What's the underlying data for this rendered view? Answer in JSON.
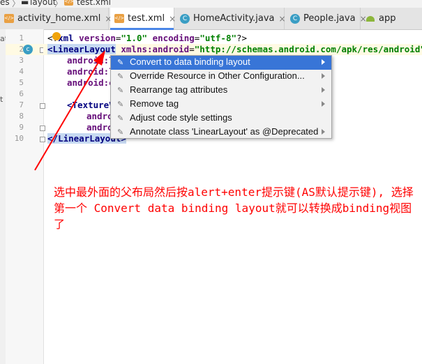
{
  "breadcrumb": {
    "items": [
      "es",
      "layout",
      "test.xml"
    ],
    "separator": "〉"
  },
  "tabs": [
    {
      "label": "activity_home.xml",
      "icon": "xml-file-icon",
      "close": "×"
    },
    {
      "label": "test.xml",
      "icon": "xml-file-icon",
      "close": "×",
      "active": true
    },
    {
      "label": "HomeActivity.java",
      "icon": "class-icon",
      "close": "×"
    },
    {
      "label": "People.java",
      "icon": "class-icon",
      "close": "×"
    },
    {
      "label": "app",
      "icon": "android-icon"
    }
  ],
  "left_panel": {
    "fragments": [
      "at",
      "t"
    ]
  },
  "gutter": {
    "line_numbers": [
      "1",
      "2",
      "3",
      "4",
      "5",
      "6",
      "7",
      "8",
      "9",
      "10"
    ],
    "class_badge": "c"
  },
  "code": {
    "line1": {
      "open": "<?",
      "name": "xml",
      "a1": "version",
      "v1": "\"1.0\"",
      "a2": "encoding",
      "v2": "\"utf-8\"",
      "close": "?>"
    },
    "line2": {
      "open": "<",
      "tag": "LinearLayout",
      "attr": "xmlns:android",
      "eq": "=",
      "val": "\"http://schemas.android.com/apk/res/android\""
    },
    "line3": "android:l",
    "line4": "android:l",
    "line5": "android:o",
    "line7": "<TextureV",
    "line8": "andro",
    "line9": "andro",
    "line10": {
      "open": "</",
      "tag": "LinearLayout",
      "close": ">"
    }
  },
  "context_menu": {
    "items": [
      {
        "label": "Convert to data binding layout",
        "icon": "pencil-icon",
        "submenu": true,
        "active": true
      },
      {
        "label": "Override Resource in Other Configuration...",
        "icon": "pencil-icon",
        "submenu": true
      },
      {
        "label": "Rearrange tag attributes",
        "icon": "pencil-icon",
        "submenu": true
      },
      {
        "label": "Remove tag",
        "icon": "pencil-icon",
        "submenu": true
      },
      {
        "label": "Adjust code style settings",
        "icon": "pencil-icon",
        "submenu": false
      },
      {
        "label": "Annotate class 'LinearLayout' as @Deprecated",
        "icon": "pencil-icon",
        "submenu": true
      }
    ]
  },
  "annotation": {
    "text": "选中最外面的父布局然后按alert+enter提示键(AS默认提示键), 选择第一个 Convert data binding layout就可以转换成binding视图了",
    "color": "#ff0000"
  },
  "colors": {
    "accent": "#3875d7",
    "tab_underline": "#4a86e8",
    "selection": "#c6d9f1",
    "annotation": "#ff0000"
  }
}
